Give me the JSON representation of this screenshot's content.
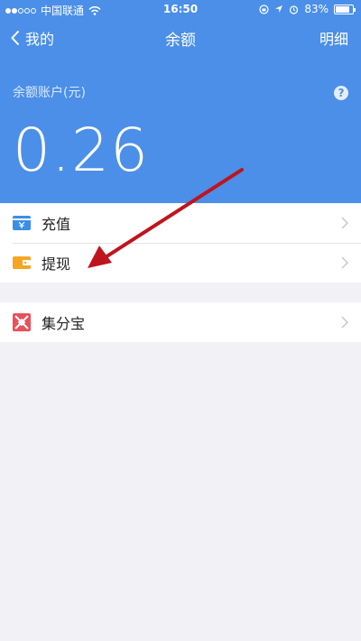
{
  "status": {
    "carrier": "中国联通",
    "time": "16:50",
    "battery": "83%",
    "battery_level": 0.83
  },
  "nav": {
    "back_label": "我的",
    "title": "余额",
    "detail_label": "明细"
  },
  "balance": {
    "label": "余额账户(元)",
    "amount": "0.26",
    "help_symbol": "?"
  },
  "menu": {
    "recharge": "充值",
    "withdraw": "提现",
    "jifenbao": "集分宝"
  },
  "colors": {
    "header": "#4b8fe8",
    "recharge_icon": "#3a8ee6",
    "withdraw_icon": "#f5a623",
    "jifenbao_icon": "#e9505a",
    "annotation_arrow": "#c0141c"
  }
}
